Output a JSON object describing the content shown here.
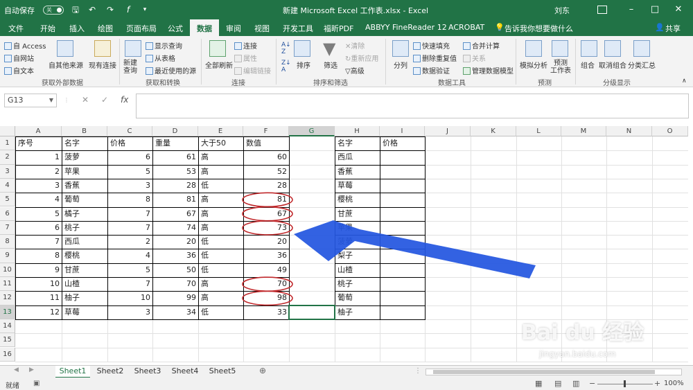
{
  "titlebar": {
    "autosave_label": "自动保存",
    "autosave_state": "关",
    "title": "新建 Microsoft Excel 工作表.xlsx  -  Excel",
    "user": "刘东",
    "icons": [
      "save-icon",
      "undo-icon",
      "redo-icon",
      "fx-icon",
      "customize-icon"
    ]
  },
  "menu": {
    "tabs": [
      "文件",
      "开始",
      "插入",
      "绘图",
      "页面布局",
      "公式",
      "数据",
      "审阅",
      "视图",
      "开发工具",
      "福昕PDF",
      "ABBYY FineReader 12",
      "ACROBAT"
    ],
    "active": "数据",
    "tellme": "告诉我你想要做什么",
    "share": "共享"
  },
  "ribbon": {
    "access": "自 Access",
    "web": "自网站",
    "text": "自文本",
    "other_sources": "自其他来源",
    "existing": "现有连接",
    "group1": "获取外部数据",
    "new_query": "新建\n查询",
    "show_queries": "显示查询",
    "from_table": "从表格",
    "recent_sources": "最近使用的源",
    "group2": "获取和转换",
    "refresh_all": "全部刷新",
    "connections": "连接",
    "properties": "属性",
    "edit_links": "编辑链接",
    "group3": "连接",
    "sort": "排序",
    "filter": "筛选",
    "clear": "清除",
    "reapply": "重新应用",
    "advanced": "高级",
    "group4": "排序和筛选",
    "text_to_columns": "分列",
    "flash_fill": "快速填充",
    "remove_dup": "删除重复值",
    "data_validation": "数据验证",
    "consolidate": "合并计算",
    "relationships": "关系",
    "manage_model": "管理数据模型",
    "group5": "数据工具",
    "what_if": "模拟分析",
    "forecast_sheet": "预测\n工作表",
    "group6": "预测",
    "group_btn": "组合",
    "ungroup": "取消组合",
    "subtotal": "分类汇总",
    "group7": "分级显示"
  },
  "formula": {
    "namebox": "G13",
    "content": ""
  },
  "grid": {
    "columns": [
      "A",
      "B",
      "C",
      "D",
      "E",
      "F",
      "G",
      "H",
      "I",
      "J",
      "K",
      "L",
      "M",
      "N",
      "O"
    ],
    "selected_col": "G",
    "rows": [
      "1",
      "2",
      "3",
      "4",
      "5",
      "6",
      "7",
      "8",
      "9",
      "10",
      "11",
      "12",
      "13",
      "14",
      "15",
      "16"
    ],
    "selected_row": "13",
    "header_A": "序号",
    "header_B": "名字",
    "header_C": "价格",
    "header_D": "重量",
    "header_E": "大于50",
    "header_F": "数值",
    "header_H": "名字",
    "header_I": "价格",
    "data": [
      [
        "1",
        "菠萝",
        "6",
        "61",
        "高",
        "60"
      ],
      [
        "2",
        "苹果",
        "5",
        "53",
        "高",
        "52"
      ],
      [
        "3",
        "香蕉",
        "3",
        "28",
        "低",
        "28"
      ],
      [
        "4",
        "葡萄",
        "8",
        "81",
        "高",
        "81"
      ],
      [
        "5",
        "橘子",
        "7",
        "67",
        "高",
        "67"
      ],
      [
        "6",
        "桃子",
        "7",
        "74",
        "高",
        "73"
      ],
      [
        "7",
        "西瓜",
        "2",
        "20",
        "低",
        "20"
      ],
      [
        "8",
        "樱桃",
        "4",
        "36",
        "低",
        "36"
      ],
      [
        "9",
        "甘蔗",
        "5",
        "50",
        "低",
        "49"
      ],
      [
        "10",
        "山楂",
        "7",
        "70",
        "高",
        "70"
      ],
      [
        "11",
        "柚子",
        "10",
        "99",
        "高",
        "98"
      ],
      [
        "12",
        "草莓",
        "3",
        "34",
        "低",
        "33"
      ]
    ],
    "h_names": [
      "西瓜",
      "香蕉",
      "草莓",
      "樱桃",
      "甘蔗",
      "苹果",
      "菠萝",
      "梨子",
      "山楂",
      "桃子",
      "葡萄",
      "柚子"
    ],
    "circled_rows": [
      "5",
      "6",
      "7",
      "11",
      "12"
    ]
  },
  "sheets": {
    "tabs": [
      "Sheet1",
      "Sheet2",
      "Sheet3",
      "Sheet4",
      "Sheet5"
    ],
    "active": "Sheet1"
  },
  "status": {
    "ready": "就绪",
    "zoom": "100%"
  },
  "watermark": {
    "brand": "Bai du 经验",
    "url": "jingyan.baidu.com"
  },
  "colors": {
    "excel_green": "#217346",
    "annotation_circle": "#c0282b",
    "annotation_arrow": "#2356e0"
  }
}
